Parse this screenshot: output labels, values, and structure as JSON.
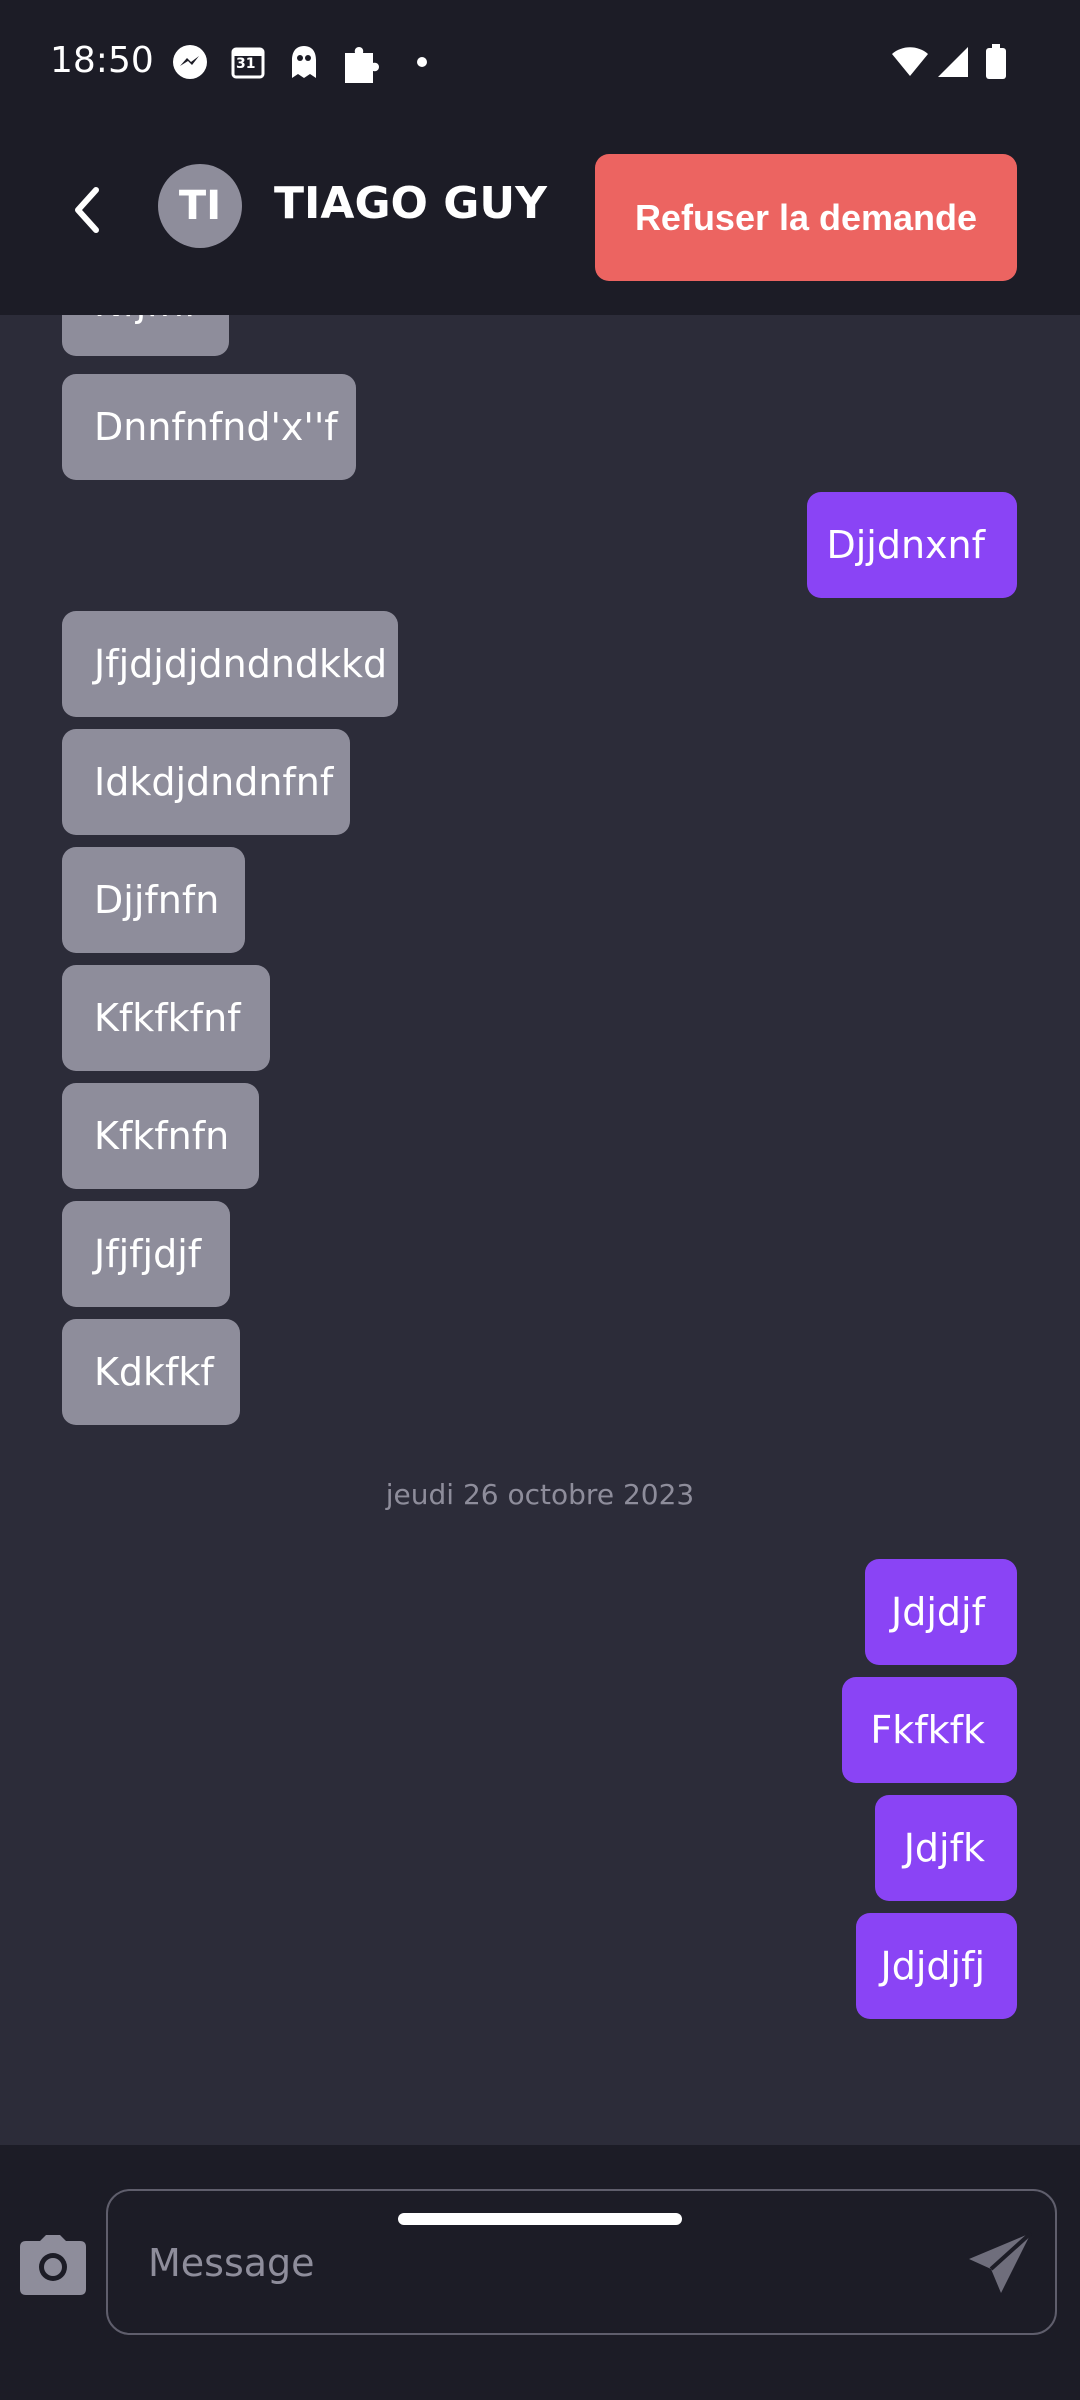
{
  "status": {
    "time": "18:50",
    "calendar_day": "31",
    "icons": [
      "messenger-icon",
      "calendar-icon",
      "ghost-icon",
      "puzzle-icon",
      "dot-icon",
      "wifi-icon",
      "signal-icon",
      "battery-icon"
    ]
  },
  "header": {
    "avatar_initials": "TI",
    "contact_name": "TIAGO GUY",
    "refuse_label": "Refuser la demande"
  },
  "messages": [
    {
      "dir": "in",
      "text": "Nfjfnf"
    },
    {
      "dir": "in",
      "text": "Dnnfnfnd'x''f"
    },
    {
      "dir": "out",
      "text": "Djjdnxnf"
    },
    {
      "dir": "in",
      "text": "Jfjdjdjdndndkkd"
    },
    {
      "dir": "in",
      "text": "Idkdjdndnfnf"
    },
    {
      "dir": "in",
      "text": "Djjfnfn"
    },
    {
      "dir": "in",
      "text": "Kfkfkfnf"
    },
    {
      "dir": "in",
      "text": "Kfkfnfn"
    },
    {
      "dir": "in",
      "text": "Jfjfjdjf"
    },
    {
      "dir": "in",
      "text": "Kdkfkf"
    },
    {
      "dir": "out",
      "text": "Jdjdjf"
    },
    {
      "dir": "out",
      "text": "Fkfkfk"
    },
    {
      "dir": "out",
      "text": "Jdjfk"
    },
    {
      "dir": "out",
      "text": "Jdjdjfj"
    }
  ],
  "date_separator": "jeudi 26 octobre 2023",
  "composer": {
    "placeholder": "Message"
  },
  "colors": {
    "background": "#2c2c39",
    "bar": "#1c1c26",
    "incoming_bubble": "#8e8d9b",
    "outgoing_bubble": "#8a44f5",
    "refuse_button": "#ec6461"
  }
}
